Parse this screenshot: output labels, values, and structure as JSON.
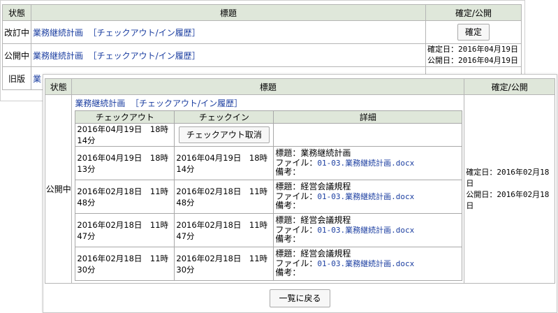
{
  "back": {
    "headers": {
      "status": "状態",
      "title": "標題",
      "confirm": "確定/公開"
    },
    "rows": [
      {
        "status": "改訂中",
        "title": "業務継続計画",
        "history": "［チェックアウト/イン履歴］",
        "button": "確定"
      },
      {
        "status": "公開中",
        "title": "業務継続計画",
        "history": "［チェックアウト/イン履歴］",
        "confirm_line": "確定日：2016年04月19日",
        "publish_line": "公開日：2016年04月19日"
      },
      {
        "status": "旧版",
        "title": "業"
      }
    ]
  },
  "front": {
    "headers": {
      "status": "状態",
      "title": "標題",
      "confirm": "確定/公開"
    },
    "status": "公開中",
    "title": "業務継続計画",
    "history": "［チェックアウト/イン履歴］",
    "confirm_line": "確定日：2016年02月18日",
    "publish_line": "公開日：2016年02月18日",
    "history_table": {
      "headers": {
        "checkout": "チェックアウト",
        "checkin": "チェックイン",
        "detail": "詳細"
      },
      "cancel_button": "チェックアウト取消",
      "rows": [
        {
          "checkout": "2016年04月19日　18時14分"
        },
        {
          "checkout": "2016年04月19日　18時13分",
          "checkin": "2016年04月19日　18時14分",
          "title_line": "標題：業務継続計画",
          "file_label": "ファイル：",
          "file_name": "01-03.業務継続計画.docx",
          "note": "備考："
        },
        {
          "checkout": "2016年02月18日　11時48分",
          "checkin": "2016年02月18日　11時48分",
          "title_line": "標題：経営会議規程",
          "file_label": "ファイル：",
          "file_name": "01-03.業務継続計画.docx",
          "note": "備考："
        },
        {
          "checkout": "2016年02月18日　11時47分",
          "checkin": "2016年02月18日　11時47分",
          "title_line": "標題：経営会議規程",
          "file_label": "ファイル：",
          "file_name": "01-03.業務継続計画.docx",
          "note": "備考："
        },
        {
          "checkout": "2016年02月18日　11時30分",
          "checkin": "2016年02月18日　11時30分",
          "title_line": "標題：経営会議規程",
          "file_label": "ファイル：",
          "file_name": "01-03.業務継続計画.docx",
          "note": "備考："
        }
      ]
    },
    "back_button": "一覧に戻る"
  }
}
